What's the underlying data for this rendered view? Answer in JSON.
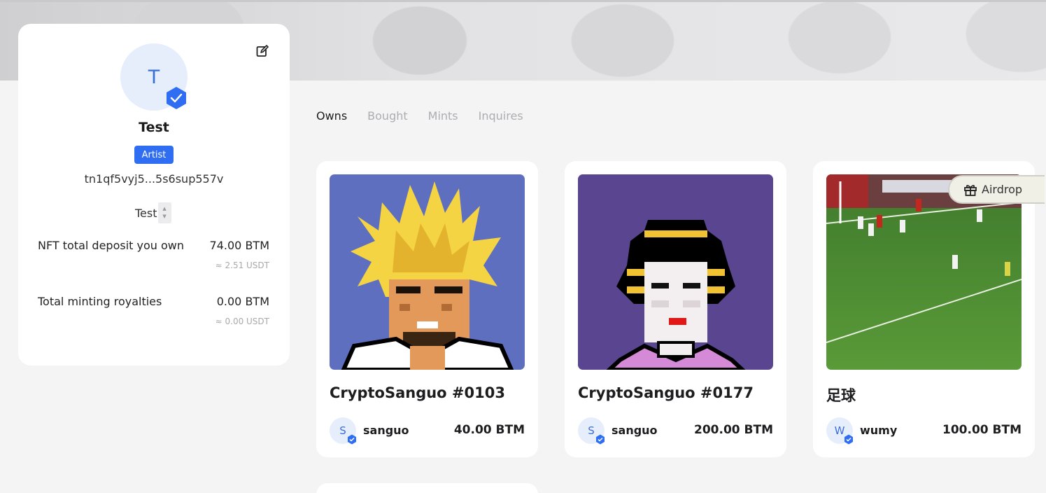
{
  "profile": {
    "avatar_initial": "T",
    "name": "Test",
    "role_badge": "Artist",
    "address": "tn1qf5vyj5...5s6sup557v",
    "selector_value": "Test",
    "stats": [
      {
        "label": "NFT total deposit you own",
        "value": "74.00 BTM",
        "sub": "≈ 2.51 USDT"
      },
      {
        "label": "Total minting royalties",
        "value": "0.00 BTM",
        "sub": "≈ 0.00 USDT"
      }
    ]
  },
  "tabs": [
    {
      "label": "Owns",
      "active": true
    },
    {
      "label": "Bought",
      "active": false
    },
    {
      "label": "Mints",
      "active": false
    },
    {
      "label": "Inquires",
      "active": false
    }
  ],
  "cards": [
    {
      "title": "CryptoSanguo #0103",
      "owner_initial": "S",
      "owner": "sanguo",
      "price": "40.00 BTM",
      "image": "pixel-art-blond-spiky-hair-character"
    },
    {
      "title": "CryptoSanguo #0177",
      "owner_initial": "S",
      "owner": "sanguo",
      "price": "200.00 BTM",
      "image": "pixel-art-geisha-character"
    },
    {
      "title": "足球",
      "owner_initial": "W",
      "owner": "wumy",
      "price": "100.00 BTM",
      "image": "football-match-photo"
    }
  ],
  "airdrop": {
    "label": "Airdrop",
    "icon": "gift-icon"
  },
  "colors": {
    "accent": "#2f6ef2",
    "page_bg": "#f4f4f5",
    "card_bg": "#ffffff"
  }
}
